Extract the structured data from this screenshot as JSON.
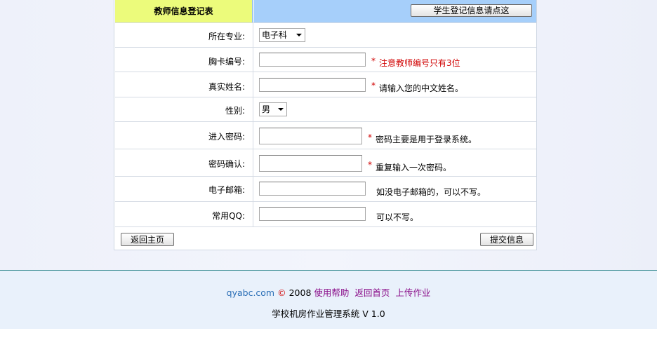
{
  "form": {
    "title": "教师信息登记表",
    "student_button": "学生登记信息请点这",
    "fields": {
      "major": {
        "label": "所在专业:",
        "value": "电子科"
      },
      "card": {
        "label": "胸卡编号:",
        "value": "",
        "hint": "注意教师编号只有3位"
      },
      "name": {
        "label": "真实姓名:",
        "value": "",
        "hint": "请输入您的中文姓名。"
      },
      "gender": {
        "label": "性别:",
        "value": "男"
      },
      "password": {
        "label": "进入密码:",
        "value": "",
        "hint": "密码主要是用于登录系统。"
      },
      "confirm": {
        "label": "密码确认:",
        "value": "",
        "hint": "重复输入一次密码。"
      },
      "email": {
        "label": "电子邮箱:",
        "value": "",
        "hint": "如没电子邮箱的，可以不写。"
      },
      "qq": {
        "label": "常用QQ:",
        "value": "",
        "hint": "可以不写。"
      }
    },
    "required_mark": "*",
    "back_button": "返回主页",
    "submit_button": "提交信息"
  },
  "footer": {
    "site": "qyabc.com",
    "copyright_symbol": "©",
    "year": "2008",
    "links": [
      "使用帮助",
      "返回首页",
      "上传作业"
    ],
    "system_name": "学校机房作业管理系统 V 1.0"
  },
  "colors": {
    "header_left": "#ecfb7b",
    "header_right": "#a6cffa",
    "required": "#d00000",
    "link": "#8a0f8a"
  }
}
